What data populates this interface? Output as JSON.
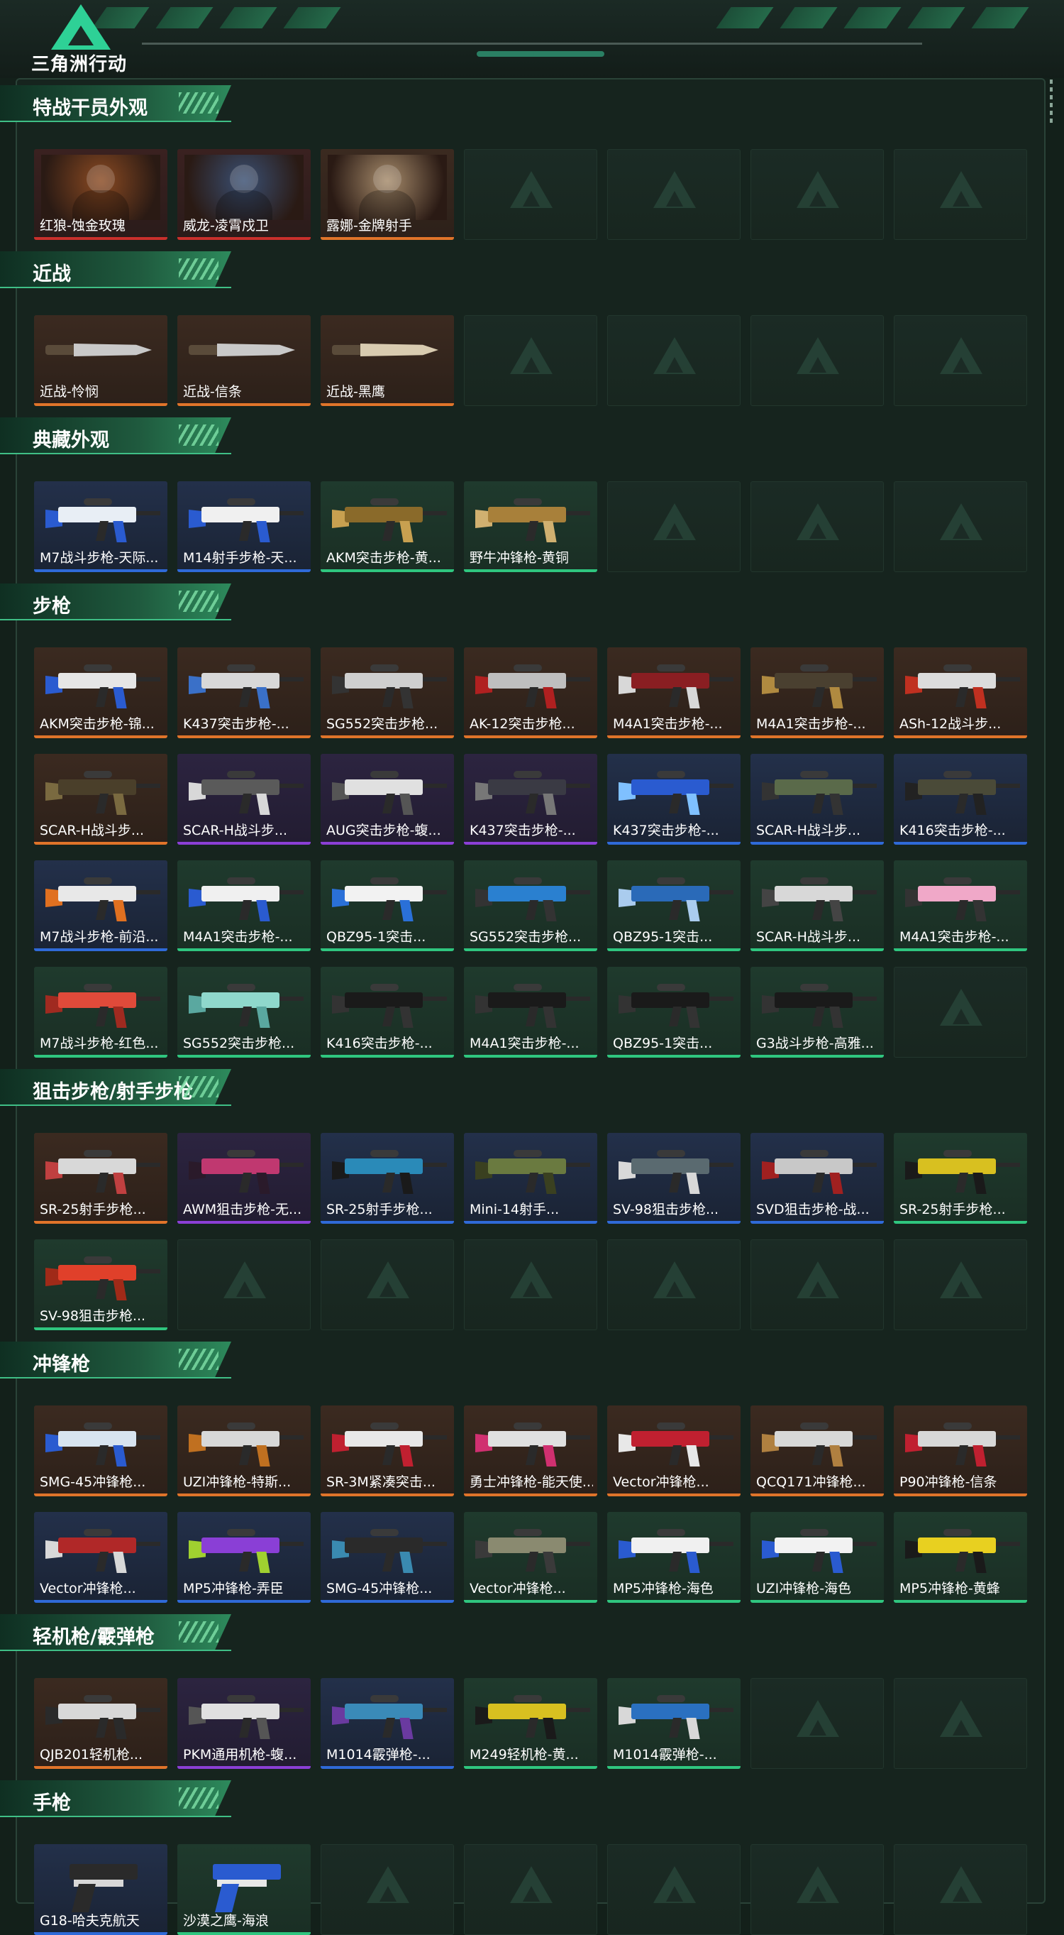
{
  "header": {
    "logo_text": "三角洲行动"
  },
  "sections": [
    {
      "title": "特战干员外观",
      "rows": [
        [
          {
            "label": "红狼-蚀金玫瑰",
            "rarity": "red",
            "kind": "portrait",
            "color": "#8a4a22"
          },
          {
            "label": "威龙-凌霄戍卫",
            "rarity": "red",
            "kind": "portrait",
            "color": "#3a4f72"
          },
          {
            "label": "露娜-金牌射手",
            "rarity": "orange",
            "kind": "portrait",
            "color": "#a58a6a"
          },
          {
            "label": "",
            "rarity": "empty"
          },
          {
            "label": "",
            "rarity": "empty"
          },
          {
            "label": "",
            "rarity": "empty"
          },
          {
            "label": "",
            "rarity": "empty"
          }
        ]
      ]
    },
    {
      "title": "近战",
      "rows": [
        [
          {
            "label": "近战-怜悯",
            "rarity": "orange",
            "kind": "knife",
            "color": "#c9c9c9"
          },
          {
            "label": "近战-信条",
            "rarity": "orange",
            "kind": "knife",
            "color": "#c9c9c9"
          },
          {
            "label": "近战-黑鹰",
            "rarity": "orange",
            "kind": "knife",
            "color": "#d8cbb0"
          },
          {
            "label": "",
            "rarity": "empty"
          },
          {
            "label": "",
            "rarity": "empty"
          },
          {
            "label": "",
            "rarity": "empty"
          },
          {
            "label": "",
            "rarity": "empty"
          }
        ]
      ]
    },
    {
      "title": "典藏外观",
      "rows": [
        [
          {
            "label": "M7战斗步枪-天际...",
            "rarity": "blue",
            "kind": "gun",
            "color": "#e8eef5",
            "accent": "#2a5bd0"
          },
          {
            "label": "M14射手步枪-天...",
            "rarity": "blue",
            "kind": "gun",
            "color": "#f0f0f0",
            "accent": "#2a5bd0"
          },
          {
            "label": "AKM突击步枪-黄...",
            "rarity": "green",
            "kind": "gun",
            "color": "#8a6a2a",
            "accent": "#c8a050"
          },
          {
            "label": "野牛冲锋枪-黄铜",
            "rarity": "green",
            "kind": "gun",
            "color": "#a8803a",
            "accent": "#d0b070"
          },
          {
            "label": "",
            "rarity": "empty"
          },
          {
            "label": "",
            "rarity": "empty"
          },
          {
            "label": "",
            "rarity": "empty"
          }
        ]
      ]
    },
    {
      "title": "步枪",
      "rows": [
        [
          {
            "label": "AKM突击步枪-锦...",
            "rarity": "orange",
            "kind": "gun",
            "color": "#e6e6e6",
            "accent": "#2a5bd0"
          },
          {
            "label": "K437突击步枪-...",
            "rarity": "orange",
            "kind": "gun",
            "color": "#d8d8d8",
            "accent": "#3a70c8"
          },
          {
            "label": "SG552突击步枪...",
            "rarity": "orange",
            "kind": "gun",
            "color": "#cfcfcf",
            "accent": "#333333"
          },
          {
            "label": "AK-12突击步枪...",
            "rarity": "orange",
            "kind": "gun",
            "color": "#bfbfbf",
            "accent": "#b02020"
          },
          {
            "label": "M4A1突击步枪-...",
            "rarity": "orange",
            "kind": "gun",
            "color": "#8a1e22",
            "accent": "#d8d8d8"
          },
          {
            "label": "M4A1突击步枪-...",
            "rarity": "orange",
            "kind": "gun",
            "color": "#4a4030",
            "accent": "#b08a40"
          },
          {
            "label": "ASh-12战斗步...",
            "rarity": "orange",
            "kind": "gun",
            "color": "#dcdcdc",
            "accent": "#c03020"
          }
        ],
        [
          {
            "label": "SCAR-H战斗步...",
            "rarity": "orange",
            "kind": "gun",
            "color": "#4a3f2a",
            "accent": "#7a6a40"
          },
          {
            "label": "SCAR-H战斗步...",
            "rarity": "purple",
            "kind": "gun",
            "color": "#5a5a5a",
            "accent": "#d8d8d8"
          },
          {
            "label": "AUG突击步枪-蝮...",
            "rarity": "purple",
            "kind": "gun",
            "color": "#e0e0e0",
            "accent": "#555555"
          },
          {
            "label": "K437突击步枪-...",
            "rarity": "purple",
            "kind": "gun",
            "color": "#3a3a44",
            "accent": "#777777"
          },
          {
            "label": "K437突击步枪-...",
            "rarity": "blue",
            "kind": "gun",
            "color": "#2a5bd0",
            "accent": "#7fc0ff"
          },
          {
            "label": "SCAR-H战斗步...",
            "rarity": "blue",
            "kind": "gun",
            "color": "#5a6a4a",
            "accent": "#333333"
          },
          {
            "label": "K416突击步枪-...",
            "rarity": "blue",
            "kind": "gun",
            "color": "#4a4a38",
            "accent": "#222222"
          }
        ],
        [
          {
            "label": "M7战斗步枪-前沿...",
            "rarity": "blue",
            "kind": "gun",
            "color": "#e8e8e8",
            "accent": "#e07020"
          },
          {
            "label": "M4A1突击步枪-...",
            "rarity": "green",
            "kind": "gun",
            "color": "#f0f0f0",
            "accent": "#2a5bd0"
          },
          {
            "label": "QBZ95-1突击...",
            "rarity": "green",
            "kind": "gun",
            "color": "#f2f2f2",
            "accent": "#2a70d8"
          },
          {
            "label": "SG552突击步枪...",
            "rarity": "green",
            "kind": "gun",
            "color": "#2a80d0",
            "accent": "#333333"
          },
          {
            "label": "QBZ95-1突击...",
            "rarity": "green",
            "kind": "gun",
            "color": "#2a6ab8",
            "accent": "#aaccee"
          },
          {
            "label": "SCAR-H战斗步...",
            "rarity": "green",
            "kind": "gun",
            "color": "#d8d8d8",
            "accent": "#444444"
          },
          {
            "label": "M4A1突击步枪-...",
            "rarity": "green",
            "kind": "gun",
            "color": "#f0a8c8",
            "accent": "#333333"
          }
        ],
        [
          {
            "label": "M7战斗步枪-红色...",
            "rarity": "green",
            "kind": "gun",
            "color": "#e04a3a",
            "accent": "#a02a20"
          },
          {
            "label": "SG552突击步枪...",
            "rarity": "green",
            "kind": "gun",
            "color": "#8fd8cc",
            "accent": "#5aa8a0"
          },
          {
            "label": "K416突击步枪-...",
            "rarity": "green",
            "kind": "gun",
            "color": "#1a1a1a",
            "accent": "#333333"
          },
          {
            "label": "M4A1突击步枪-...",
            "rarity": "green",
            "kind": "gun",
            "color": "#1a1a1a",
            "accent": "#333333"
          },
          {
            "label": "QBZ95-1突击...",
            "rarity": "green",
            "kind": "gun",
            "color": "#1a1a1a",
            "accent": "#333333"
          },
          {
            "label": "G3战斗步枪-高雅...",
            "rarity": "green",
            "kind": "gun",
            "color": "#1a1a1a",
            "accent": "#333333"
          },
          {
            "label": "",
            "rarity": "empty"
          }
        ]
      ]
    },
    {
      "title": "狙击步枪/射手步枪",
      "rows": [
        [
          {
            "label": "SR-25射手步枪...",
            "rarity": "orange",
            "kind": "gun",
            "color": "#d8d8d8",
            "accent": "#c04040"
          },
          {
            "label": "AWM狙击步枪-无...",
            "rarity": "purple",
            "kind": "gun",
            "color": "#c03870",
            "accent": "#2a1a2a"
          },
          {
            "label": "SR-25射手步枪...",
            "rarity": "blue",
            "kind": "gun",
            "color": "#2a8ab8",
            "accent": "#1a1a1a"
          },
          {
            "label": "Mini-14射手...",
            "rarity": "blue",
            "kind": "gun",
            "color": "#6a7a40",
            "accent": "#3a4020"
          },
          {
            "label": "SV-98狙击步枪...",
            "rarity": "blue",
            "kind": "gun",
            "color": "#5a6a70",
            "accent": "#d8d8d8"
          },
          {
            "label": "SVD狙击步枪-战...",
            "rarity": "blue",
            "kind": "gun",
            "color": "#c8c8c8",
            "accent": "#a02020"
          },
          {
            "label": "SR-25射手步枪...",
            "rarity": "green",
            "kind": "gun",
            "color": "#d8c020",
            "accent": "#1a1a1a"
          }
        ],
        [
          {
            "label": "SV-98狙击步枪...",
            "rarity": "green",
            "kind": "gun",
            "color": "#e0402a",
            "accent": "#a02a18"
          },
          {
            "label": "",
            "rarity": "empty"
          },
          {
            "label": "",
            "rarity": "empty"
          },
          {
            "label": "",
            "rarity": "empty"
          },
          {
            "label": "",
            "rarity": "empty"
          },
          {
            "label": "",
            "rarity": "empty"
          },
          {
            "label": "",
            "rarity": "empty"
          }
        ]
      ]
    },
    {
      "title": "冲锋枪",
      "rows": [
        [
          {
            "label": "SMG-45冲锋枪...",
            "rarity": "orange",
            "kind": "gun",
            "color": "#d8e4f0",
            "accent": "#2a5bd0"
          },
          {
            "label": "UZI冲锋枪-特斯...",
            "rarity": "orange",
            "kind": "gun",
            "color": "#d8d8d8",
            "accent": "#c07020"
          },
          {
            "label": "SR-3M紧凑突击...",
            "rarity": "orange",
            "kind": "gun",
            "color": "#e8e8e8",
            "accent": "#c02030"
          },
          {
            "label": "勇士冲锋枪-能天使...",
            "rarity": "orange",
            "kind": "gun",
            "color": "#e0e0e0",
            "accent": "#d03070"
          },
          {
            "label": "Vector冲锋枪...",
            "rarity": "orange",
            "kind": "gun",
            "color": "#c02030",
            "accent": "#e8e8e8"
          },
          {
            "label": "QCQ171冲锋枪...",
            "rarity": "orange",
            "kind": "gun",
            "color": "#d8d8d8",
            "accent": "#b08040"
          },
          {
            "label": "P90冲锋枪-信条",
            "rarity": "orange",
            "kind": "gun",
            "color": "#d8d8d8",
            "accent": "#c02030"
          }
        ],
        [
          {
            "label": "Vector冲锋枪...",
            "rarity": "blue",
            "kind": "gun",
            "color": "#b02828",
            "accent": "#d8d8d8"
          },
          {
            "label": "MP5冲锋枪-弄臣",
            "rarity": "blue",
            "kind": "gun",
            "color": "#8a3fd6",
            "accent": "#a0d030"
          },
          {
            "label": "SMG-45冲锋枪...",
            "rarity": "blue",
            "kind": "gun",
            "color": "#2a2a2a",
            "accent": "#3a8ab0"
          },
          {
            "label": "Vector冲锋枪...",
            "rarity": "green",
            "kind": "gun",
            "color": "#8a8a70",
            "accent": "#3a3a3a"
          },
          {
            "label": "MP5冲锋枪-海色",
            "rarity": "green",
            "kind": "gun",
            "color": "#f0f0f0",
            "accent": "#2a5bd0"
          },
          {
            "label": "UZI冲锋枪-海色",
            "rarity": "green",
            "kind": "gun",
            "color": "#f2f2f2",
            "accent": "#2a5bd0"
          },
          {
            "label": "MP5冲锋枪-黄蜂",
            "rarity": "green",
            "kind": "gun",
            "color": "#e8d020",
            "accent": "#1a1a1a"
          }
        ]
      ]
    },
    {
      "title": "轻机枪/霰弹枪",
      "rows": [
        [
          {
            "label": "QJB201轻机枪...",
            "rarity": "orange",
            "kind": "gun",
            "color": "#d8d8d8",
            "accent": "#2a2a2a"
          },
          {
            "label": "PKM通用机枪-蝮...",
            "rarity": "purple",
            "kind": "gun",
            "color": "#e0e0e0",
            "accent": "#555555"
          },
          {
            "label": "M1014霰弹枪-...",
            "rarity": "blue",
            "kind": "gun",
            "color": "#3a8ab8",
            "accent": "#6a3aa0"
          },
          {
            "label": "M249轻机枪-黄...",
            "rarity": "green",
            "kind": "gun",
            "color": "#d8c020",
            "accent": "#1a1a1a"
          },
          {
            "label": "M1014霰弹枪-...",
            "rarity": "green",
            "kind": "gun",
            "color": "#2a70c0",
            "accent": "#d8d8d8"
          },
          {
            "label": "",
            "rarity": "empty"
          },
          {
            "label": "",
            "rarity": "empty"
          }
        ]
      ]
    },
    {
      "title": "手枪",
      "rows": [
        [
          {
            "label": "G18-哈夫克航天",
            "rarity": "blue",
            "kind": "pistol",
            "color": "#2a2a2a",
            "accent": "#d8d8d8"
          },
          {
            "label": "沙漠之鹰-海浪",
            "rarity": "green",
            "kind": "pistol",
            "color": "#2a5bd0",
            "accent": "#e8e8e8"
          },
          {
            "label": "",
            "rarity": "empty"
          },
          {
            "label": "",
            "rarity": "empty"
          },
          {
            "label": "",
            "rarity": "empty"
          },
          {
            "label": "",
            "rarity": "empty"
          },
          {
            "label": "",
            "rarity": "empty"
          }
        ]
      ]
    }
  ]
}
